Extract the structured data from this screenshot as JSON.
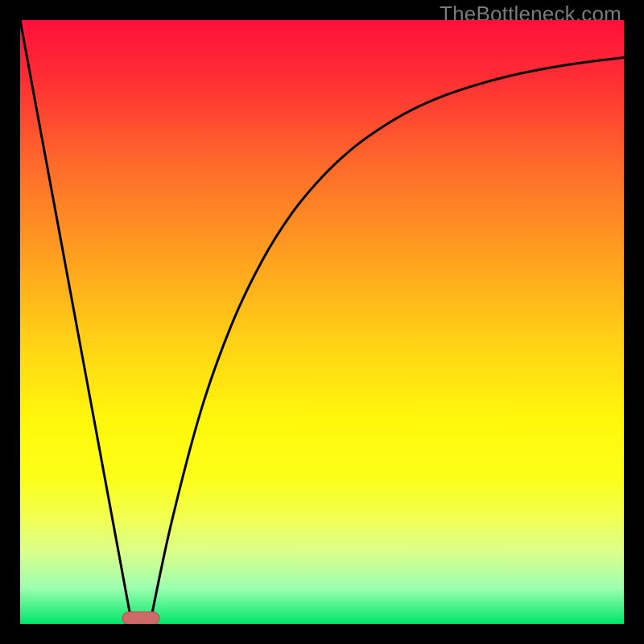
{
  "watermark": "TheBottleneck.com",
  "chart_data": {
    "type": "line",
    "title": "",
    "xlabel": "",
    "ylabel": "",
    "xlim": [
      0,
      1
    ],
    "ylim": [
      0,
      1
    ],
    "series": [
      {
        "name": "left-branch",
        "x": [
          0.0,
          0.185
        ],
        "y": [
          1.0,
          0.0
        ]
      },
      {
        "name": "right-branch",
        "x": [
          0.215,
          0.25,
          0.3,
          0.35,
          0.4,
          0.45,
          0.5,
          0.55,
          0.6,
          0.65,
          0.7,
          0.75,
          0.8,
          0.85,
          0.9,
          0.95,
          1.0
        ],
        "y": [
          0.0,
          0.165,
          0.355,
          0.495,
          0.6,
          0.68,
          0.74,
          0.787,
          0.823,
          0.852,
          0.874,
          0.891,
          0.905,
          0.916,
          0.925,
          0.932,
          0.938
        ]
      },
      {
        "name": "minimum-marker",
        "type": "marker",
        "x": 0.2,
        "y": 0.0
      }
    ],
    "gradient_stops": [
      {
        "offset": 0.0,
        "color": "#ff103b"
      },
      {
        "offset": 0.1,
        "color": "#ff2f34"
      },
      {
        "offset": 0.25,
        "color": "#ff6e2a"
      },
      {
        "offset": 0.4,
        "color": "#ffa31f"
      },
      {
        "offset": 0.55,
        "color": "#ffd714"
      },
      {
        "offset": 0.66,
        "color": "#fff70b"
      },
      {
        "offset": 0.76,
        "color": "#fcff1a"
      },
      {
        "offset": 0.82,
        "color": "#f2ff4d"
      },
      {
        "offset": 0.88,
        "color": "#dbff8a"
      },
      {
        "offset": 0.94,
        "color": "#9dffb0"
      },
      {
        "offset": 1.0,
        "color": "#00e66b"
      }
    ],
    "marker_color_fill": "#cc6b68",
    "marker_color_stroke": "#b94f4f",
    "curve_color": "#000000"
  }
}
